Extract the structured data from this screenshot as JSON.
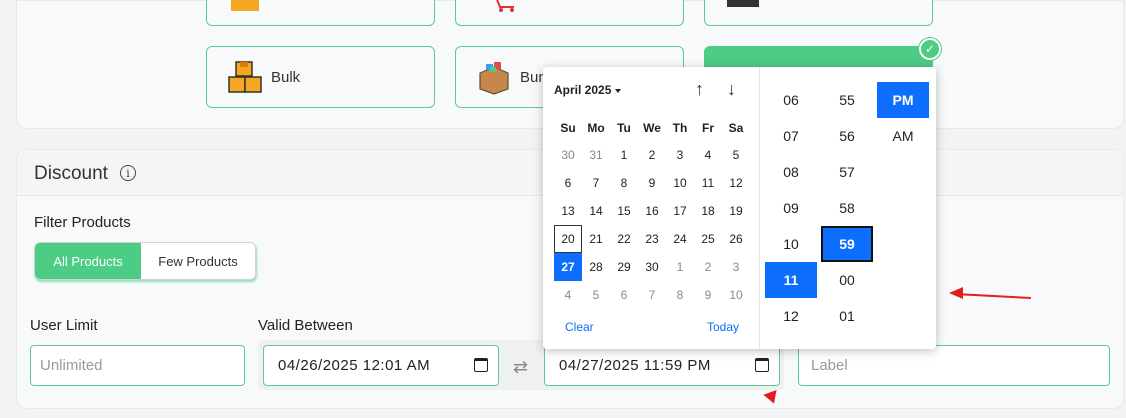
{
  "product_types": [
    {
      "label": "Bulk",
      "icon": "boxes-icon"
    },
    {
      "label": "Bun",
      "icon": "bundle-box-icon"
    }
  ],
  "discount": {
    "title": "Discount",
    "filter_label": "Filter Products",
    "filter_options": [
      "All Products",
      "Few Products"
    ],
    "user_limit_label": "User Limit",
    "user_limit_placeholder": "Unlimited",
    "valid_between_label": "Valid Between",
    "start_value": "04/26/2025  12:01  AM",
    "end_value": "04/27/2025  11:59  PM",
    "label_placeholder": "Label"
  },
  "picker": {
    "month_title": "April 2025",
    "weekdays": [
      "Su",
      "Mo",
      "Tu",
      "We",
      "Th",
      "Fr",
      "Sa"
    ],
    "weeks": [
      [
        "30",
        "31",
        "1",
        "2",
        "3",
        "4",
        "5"
      ],
      [
        "6",
        "7",
        "8",
        "9",
        "10",
        "11",
        "12"
      ],
      [
        "13",
        "14",
        "15",
        "16",
        "17",
        "18",
        "19"
      ],
      [
        "20",
        "21",
        "22",
        "23",
        "24",
        "25",
        "26"
      ],
      [
        "27",
        "28",
        "29",
        "30",
        "1",
        "2",
        "3"
      ],
      [
        "4",
        "5",
        "6",
        "7",
        "8",
        "9",
        "10"
      ]
    ],
    "clear_label": "Clear",
    "today_label": "Today",
    "hours": [
      "06",
      "07",
      "08",
      "09",
      "10",
      "11",
      "12"
    ],
    "minutes": [
      "55",
      "56",
      "57",
      "58",
      "59",
      "00",
      "01"
    ],
    "meridiem": [
      "PM",
      "AM"
    ],
    "selected_hour": "11",
    "selected_minute": "59",
    "selected_meridiem": "PM",
    "today_day": "20",
    "selected_day": "27"
  },
  "colors": {
    "accent_green": "#4ccc84",
    "picker_blue": "#0d6efd",
    "annotation_red": "#e02020"
  }
}
